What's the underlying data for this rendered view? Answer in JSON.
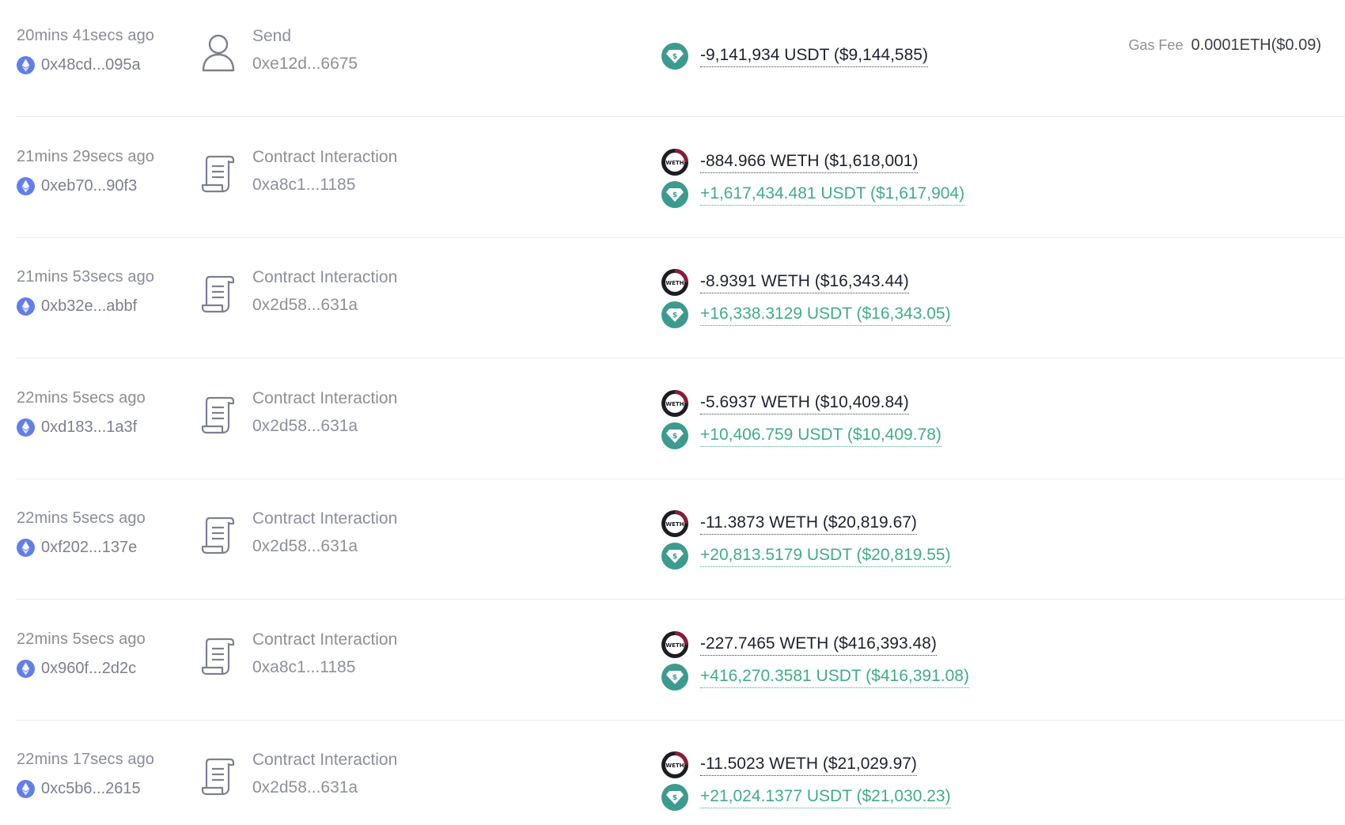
{
  "colors": {
    "eth_blue": "#627eea",
    "usdt_teal": "#3c9b8e",
    "weth_maroon": "#8a1c3a",
    "positive_green": "#3fae84",
    "negative_dark": "#1f2230"
  },
  "icons": {
    "chain": "ethereum-icon",
    "send": "user-icon",
    "contract": "scroll-document-icon",
    "usdt": "usdt-token-icon",
    "weth": "weth-token-icon"
  },
  "transactions": [
    {
      "time": "20mins 41secs ago",
      "hash": "0x48cd...095a",
      "type": "Send",
      "address": "0xe12d...6675",
      "gas_label": "Gas Fee",
      "gas_value": "0.0001ETH($0.09)",
      "amounts": [
        {
          "token": "USDT",
          "sign": "neg",
          "text": "-9,141,934 USDT ($9,144,585)"
        }
      ]
    },
    {
      "time": "21mins 29secs ago",
      "hash": "0xeb70...90f3",
      "type": "Contract Interaction",
      "address": "0xa8c1...1185",
      "amounts": [
        {
          "token": "WETH",
          "sign": "neg",
          "text": "-884.966 WETH ($1,618,001)"
        },
        {
          "token": "USDT",
          "sign": "pos",
          "text": "+1,617,434.481 USDT ($1,617,904)"
        }
      ]
    },
    {
      "time": "21mins 53secs ago",
      "hash": "0xb32e...abbf",
      "type": "Contract Interaction",
      "address": "0x2d58...631a",
      "amounts": [
        {
          "token": "WETH",
          "sign": "neg",
          "text": "-8.9391 WETH ($16,343.44)"
        },
        {
          "token": "USDT",
          "sign": "pos",
          "text": "+16,338.3129 USDT ($16,343.05)"
        }
      ]
    },
    {
      "time": "22mins 5secs ago",
      "hash": "0xd183...1a3f",
      "type": "Contract Interaction",
      "address": "0x2d58...631a",
      "amounts": [
        {
          "token": "WETH",
          "sign": "neg",
          "text": "-5.6937 WETH ($10,409.84)"
        },
        {
          "token": "USDT",
          "sign": "pos",
          "text": "+10,406.759 USDT ($10,409.78)"
        }
      ]
    },
    {
      "time": "22mins 5secs ago",
      "hash": "0xf202...137e",
      "type": "Contract Interaction",
      "address": "0x2d58...631a",
      "amounts": [
        {
          "token": "WETH",
          "sign": "neg",
          "text": "-11.3873 WETH ($20,819.67)"
        },
        {
          "token": "USDT",
          "sign": "pos",
          "text": "+20,813.5179 USDT ($20,819.55)"
        }
      ]
    },
    {
      "time": "22mins 5secs ago",
      "hash": "0x960f...2d2c",
      "type": "Contract Interaction",
      "address": "0xa8c1...1185",
      "amounts": [
        {
          "token": "WETH",
          "sign": "neg",
          "text": "-227.7465 WETH ($416,393.48)"
        },
        {
          "token": "USDT",
          "sign": "pos",
          "text": "+416,270.3581 USDT ($416,391.08)"
        }
      ]
    },
    {
      "time": "22mins 17secs ago",
      "hash": "0xc5b6...2615",
      "type": "Contract Interaction",
      "address": "0x2d58...631a",
      "amounts": [
        {
          "token": "WETH",
          "sign": "neg",
          "text": "-11.5023 WETH ($21,029.97)"
        },
        {
          "token": "USDT",
          "sign": "pos",
          "text": "+21,024.1377 USDT ($21,030.23)"
        }
      ]
    }
  ]
}
